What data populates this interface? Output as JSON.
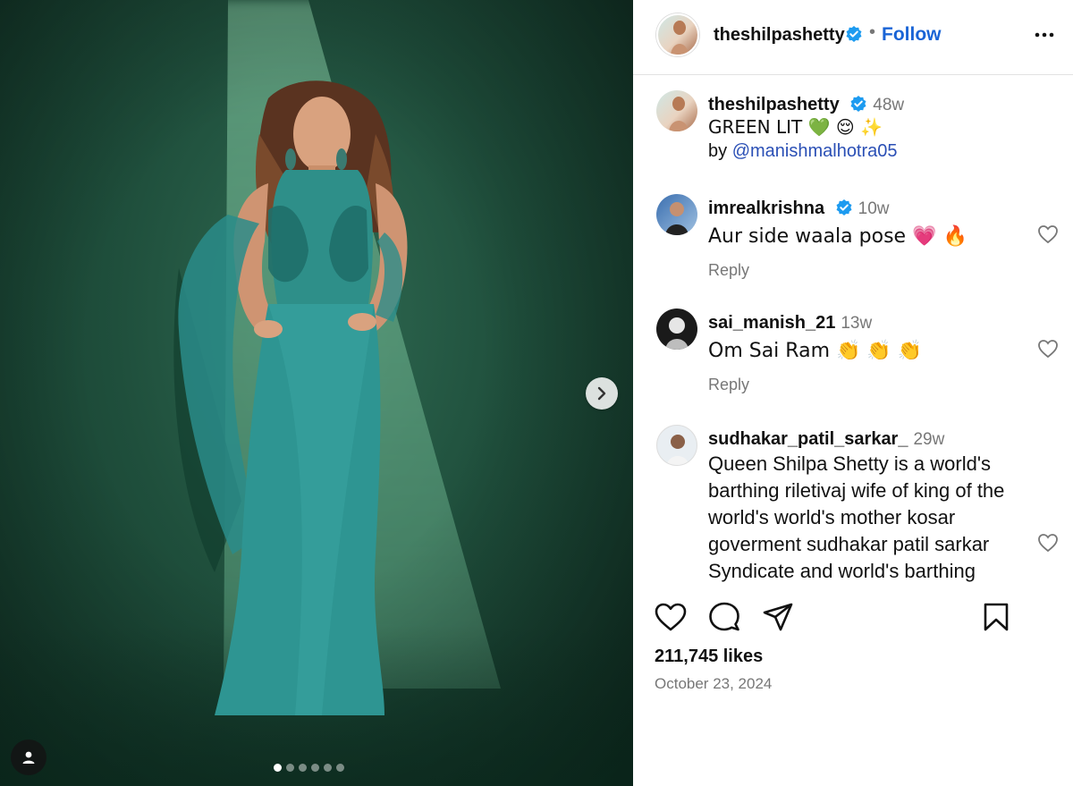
{
  "post": {
    "author": "theshilpashetty",
    "follow_label": "Follow",
    "separator": "•",
    "caption_time": "48w",
    "caption_line1": "GREEN LIT 💚 😌 ✨",
    "caption_by": "by",
    "caption_mention": "@manishmalhotra05",
    "likes": "211,745 likes",
    "date": "October 23, 2024",
    "carousel": {
      "count": 6,
      "active_index": 0
    }
  },
  "comments": [
    {
      "username": "imrealkrishna",
      "verified": true,
      "time": "10w",
      "text": "Aur side waala pose 💗 🔥",
      "reply_label": "Reply"
    },
    {
      "username": "sai_manish_21",
      "verified": false,
      "time": "13w",
      "text": "Om Sai Ram 👏 👏 👏",
      "reply_label": "Reply"
    },
    {
      "username": "sudhakar_patil_sarkar_",
      "verified": false,
      "time": "29w",
      "text": "Queen Shilpa Shetty is a world's barthing riletivaj wife of king of the world's world's mother kosar goverment sudhakar patil sarkar Syndicate and world's barthing"
    }
  ],
  "icons": {
    "verified": "verified-badge-icon",
    "more": "more-options-icon",
    "like": "heart-icon",
    "comment": "comment-icon",
    "share": "share-icon",
    "save": "bookmark-icon",
    "next": "chevron-right-icon",
    "tag": "user-tag-icon"
  },
  "colors": {
    "link": "#1a64d6",
    "verified": "#1d9bf0",
    "muted": "#777777",
    "media_bg": "#1f4f3c"
  }
}
